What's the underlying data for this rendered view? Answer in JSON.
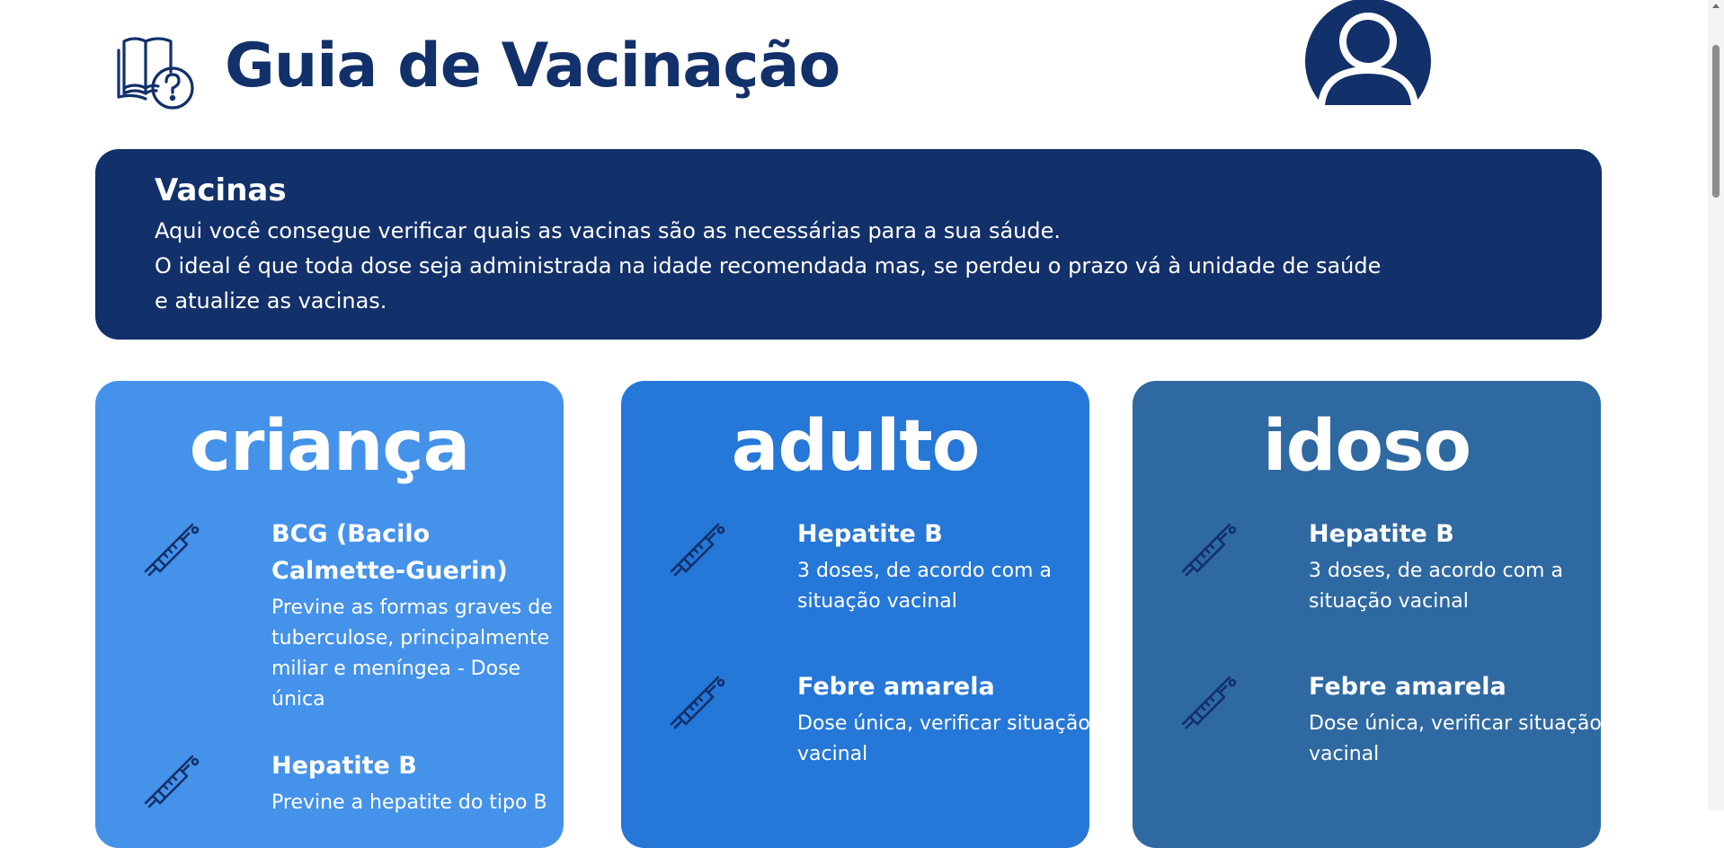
{
  "header": {
    "title": "Guia de Vacinação",
    "logo_icon": "book-question-icon",
    "avatar_icon": "user-avatar-icon"
  },
  "intro": {
    "title": "Vacinas",
    "lines": [
      "Aqui você consegue verificar quais as vacinas são as necessárias para a sua sáude.",
      "O ideal é que toda dose seja administrada na idade recomendada mas, se perdeu o prazo vá à unidade de saúde",
      "e atualize as vacinas."
    ]
  },
  "colors": {
    "brand_dark": "#12306a",
    "card_crianca": "#4592ea",
    "card_adulto": "#2577d8",
    "card_idoso": "#2f69a2"
  },
  "cards": [
    {
      "title": "criança",
      "vaccines": [
        {
          "name": "BCG (Bacilo Calmette-Guerin)",
          "desc": "Previne as formas graves de tuberculose, principalmente miliar e meníngea - Dose única",
          "icon": "syringe-icon"
        },
        {
          "name": "Hepatite B",
          "desc": "Previne a hepatite do tipo B",
          "icon": "syringe-icon"
        }
      ]
    },
    {
      "title": "adulto",
      "vaccines": [
        {
          "name": "Hepatite B",
          "desc": "3 doses, de acordo com a situação vacinal",
          "icon": "syringe-icon"
        },
        {
          "name": "Febre amarela",
          "desc": "Dose única, verificar situação vacinal",
          "icon": "syringe-icon"
        }
      ]
    },
    {
      "title": "idoso",
      "vaccines": [
        {
          "name": "Hepatite B",
          "desc": "3 doses, de acordo com a situação vacinal",
          "icon": "syringe-icon"
        },
        {
          "name": "Febre amarela",
          "desc": "Dose única, verificar situação vacinal",
          "icon": "syringe-icon"
        }
      ]
    }
  ]
}
